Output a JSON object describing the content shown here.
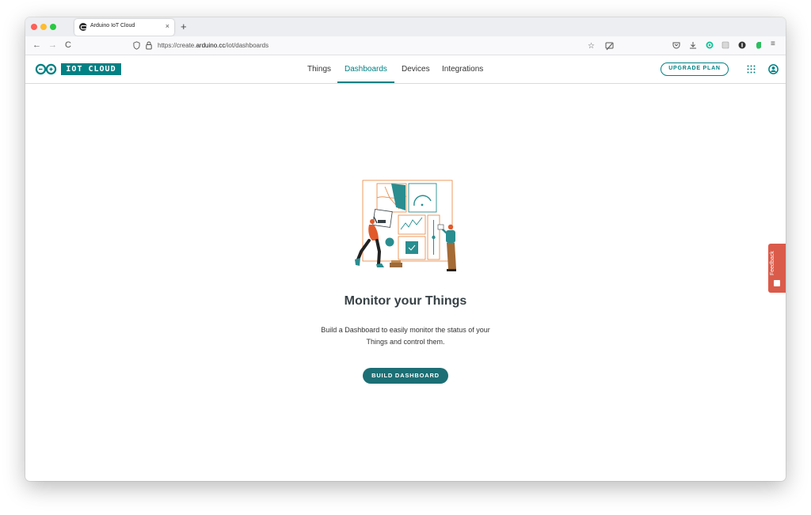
{
  "browser": {
    "tab_title": "Arduino IoT Cloud",
    "tab_close": "×",
    "new_tab": "+",
    "url_prefix": "https://create.",
    "url_domain": "arduino.cc",
    "url_path": "/iot/dashboards",
    "back": "←",
    "forward": "→",
    "reload": "C"
  },
  "header": {
    "logo_text": "IOT CLOUD",
    "nav": [
      "Things",
      "Dashboards",
      "Devices",
      "Integrations"
    ],
    "active_nav": "Dashboards",
    "upgrade_label": "UPGRADE PLAN"
  },
  "main": {
    "title": "Monitor your Things",
    "description": "Build a Dashboard to easily monitor the status of your Things and control them.",
    "build_button": "BUILD DASHBOARD"
  },
  "feedback": {
    "label": "Feedback"
  },
  "colors": {
    "accent": "#008184",
    "button": "#1c6f74",
    "feedback": "#da5b4a",
    "illustration_orange": "#e8833a"
  }
}
